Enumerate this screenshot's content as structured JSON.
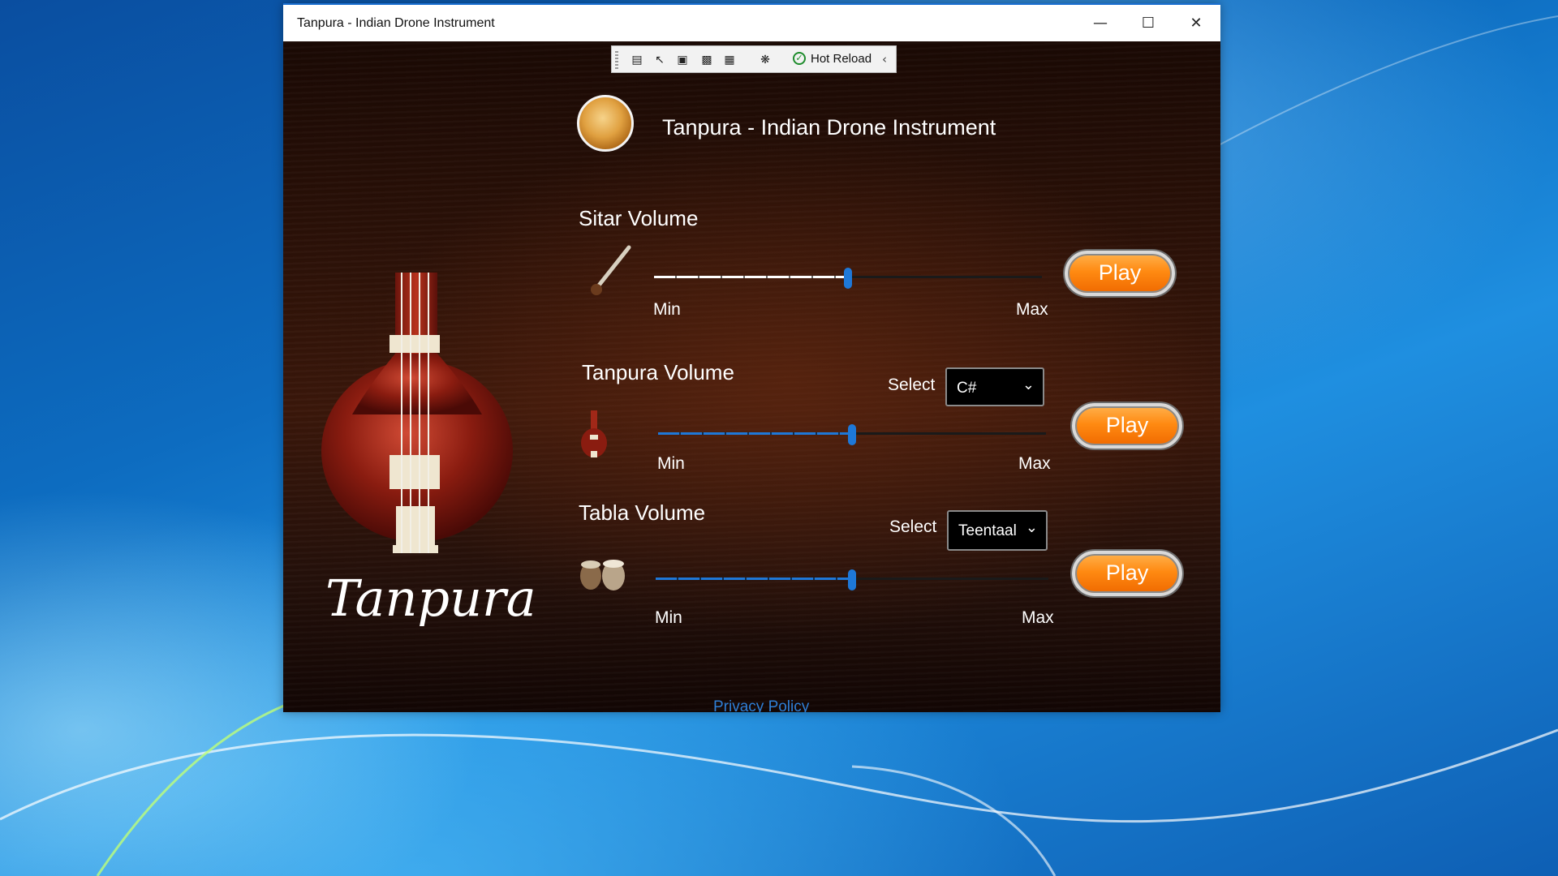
{
  "window": {
    "title": "Tanpura - Indian Drone Instrument"
  },
  "devtools": {
    "hot_reload_label": "Hot Reload"
  },
  "app": {
    "title": "Tanpura - Indian Drone Instrument",
    "brand_text": "Tanpura",
    "privacy_link": "Privacy Policy"
  },
  "sitar": {
    "label": "Sitar Volume",
    "min_label": "Min",
    "max_label": "Max",
    "volume": 0.5,
    "play_label": "Play",
    "fill_color": "#ffffff"
  },
  "tanpura": {
    "label": "Tanpura Volume",
    "select_label": "Select",
    "selected_key": "C#",
    "min_label": "Min",
    "max_label": "Max",
    "volume": 0.5,
    "play_label": "Play",
    "fill_color": "#1e78d8"
  },
  "tabla": {
    "label": "Tabla Volume",
    "select_label": "Select",
    "selected_taal": "Teentaal",
    "min_label": "Min",
    "max_label": "Max",
    "volume": 0.5,
    "play_label": "Play",
    "fill_color": "#1e78d8"
  },
  "icons": {
    "minimize": "minimize-icon",
    "maximize": "maximize-icon",
    "close": "close-icon",
    "hot_reload": "check-circle-icon",
    "chevron": "chevron-down-icon"
  },
  "colors": {
    "accent": "#1e78d8",
    "play_button": "#ff8a12",
    "link": "#2f7fd6"
  }
}
